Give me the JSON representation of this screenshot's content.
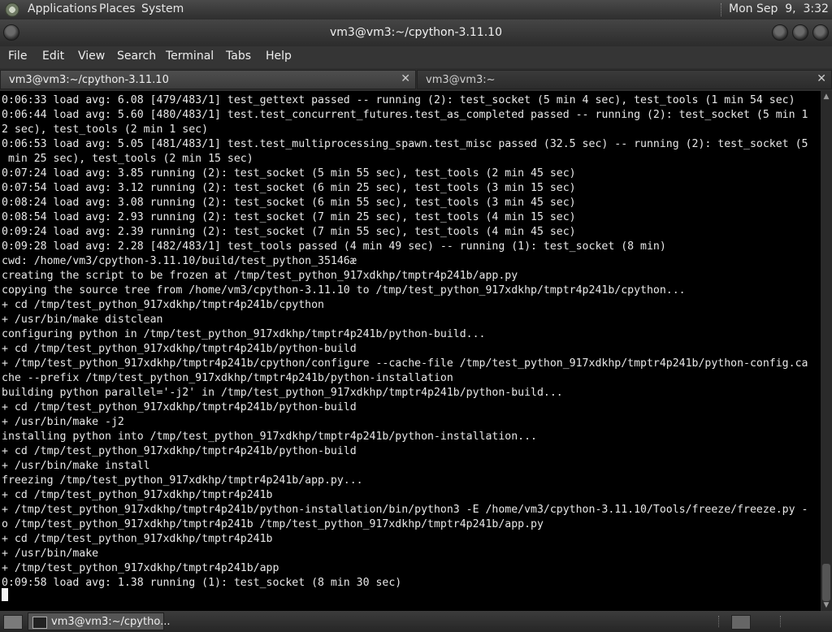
{
  "top_panel": {
    "menus": [
      "Applications",
      "Places",
      "System"
    ],
    "clock": "Mon Sep  9,  3:32 PM"
  },
  "window": {
    "title": "vm3@vm3:~/cpython-3.11.10"
  },
  "menubar": [
    "File",
    "Edit",
    "View",
    "Search",
    "Terminal",
    "Tabs",
    "Help"
  ],
  "tabs": [
    {
      "label": "vm3@vm3:~/cpython-3.11.10",
      "active": true
    },
    {
      "label": "vm3@vm3:~",
      "active": false
    }
  ],
  "terminal": {
    "lines": [
      "0:06:33 load avg: 6.08 [479/483/1] test_gettext passed -- running (2): test_socket (5 min 4 sec), test_tools (1 min 54 sec)",
      "0:06:44 load avg: 5.60 [480/483/1] test.test_concurrent_futures.test_as_completed passed -- running (2): test_socket (5 min 1",
      "2 sec), test_tools (2 min 1 sec)",
      "0:06:53 load avg: 5.05 [481/483/1] test.test_multiprocessing_spawn.test_misc passed (32.5 sec) -- running (2): test_socket (5",
      " min 25 sec), test_tools (2 min 15 sec)",
      "0:07:24 load avg: 3.85 running (2): test_socket (5 min 55 sec), test_tools (2 min 45 sec)",
      "0:07:54 load avg: 3.12 running (2): test_socket (6 min 25 sec), test_tools (3 min 15 sec)",
      "0:08:24 load avg: 3.08 running (2): test_socket (6 min 55 sec), test_tools (3 min 45 sec)",
      "0:08:54 load avg: 2.93 running (2): test_socket (7 min 25 sec), test_tools (4 min 15 sec)",
      "0:09:24 load avg: 2.39 running (2): test_socket (7 min 55 sec), test_tools (4 min 45 sec)",
      "0:09:28 load avg: 2.28 [482/483/1] test_tools passed (4 min 49 sec) -- running (1): test_socket (8 min)",
      "cwd: /home/vm3/cpython-3.11.10/build/test_python_35146æ",
      "creating the script to be frozen at /tmp/test_python_917xdkhp/tmptr4p241b/app.py",
      "copying the source tree from /home/vm3/cpython-3.11.10 to /tmp/test_python_917xdkhp/tmptr4p241b/cpython...",
      "+ cd /tmp/test_python_917xdkhp/tmptr4p241b/cpython",
      "+ /usr/bin/make distclean",
      "configuring python in /tmp/test_python_917xdkhp/tmptr4p241b/python-build...",
      "+ cd /tmp/test_python_917xdkhp/tmptr4p241b/python-build",
      "+ /tmp/test_python_917xdkhp/tmptr4p241b/cpython/configure --cache-file /tmp/test_python_917xdkhp/tmptr4p241b/python-config.ca",
      "che --prefix /tmp/test_python_917xdkhp/tmptr4p241b/python-installation",
      "building python parallel='-j2' in /tmp/test_python_917xdkhp/tmptr4p241b/python-build...",
      "+ cd /tmp/test_python_917xdkhp/tmptr4p241b/python-build",
      "+ /usr/bin/make -j2",
      "installing python into /tmp/test_python_917xdkhp/tmptr4p241b/python-installation...",
      "+ cd /tmp/test_python_917xdkhp/tmptr4p241b/python-build",
      "+ /usr/bin/make install",
      "freezing /tmp/test_python_917xdkhp/tmptr4p241b/app.py...",
      "+ cd /tmp/test_python_917xdkhp/tmptr4p241b",
      "+ /tmp/test_python_917xdkhp/tmptr4p241b/python-installation/bin/python3 -E /home/vm3/cpython-3.11.10/Tools/freeze/freeze.py -",
      "o /tmp/test_python_917xdkhp/tmptr4p241b /tmp/test_python_917xdkhp/tmptr4p241b/app.py",
      "+ cd /tmp/test_python_917xdkhp/tmptr4p241b",
      "+ /usr/bin/make",
      "+ /tmp/test_python_917xdkhp/tmptr4p241b/app",
      "0:09:58 load avg: 1.38 running (1): test_socket (8 min 30 sec)"
    ]
  },
  "taskbar": {
    "window_button": "vm3@vm3:~/cpytho..."
  }
}
